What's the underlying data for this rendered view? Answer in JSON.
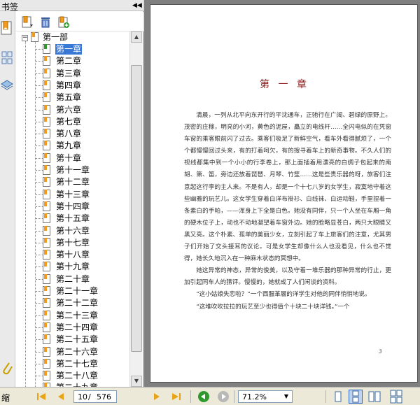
{
  "panel": {
    "title": "书签",
    "collapse_glyph": "◀◀"
  },
  "tree": {
    "expander_glyph": "−",
    "root_label": "第一部",
    "items": [
      "第一章",
      "第二章",
      "第三章",
      "第四章",
      "第五章",
      "第六章",
      "第七章",
      "第八章",
      "第九章",
      "第十章",
      "第十一章",
      "第十二章",
      "第十三章",
      "第十四章",
      "第十五章",
      "第十六章",
      "第十七章",
      "第十八章",
      "第十九章",
      "第二十章",
      "第二十一章",
      "第二十二章",
      "第二十三章",
      "第二十四章",
      "第二十五章",
      "第二十六章",
      "第二十七章",
      "第二十八章",
      "第二十九章"
    ],
    "selected_index": 0
  },
  "document": {
    "chapter_title": "第 一 章",
    "paragraphs": [
      "清晨，一列从北平向东开行的平沈通车，正驰行在广阔、碧绿的原野上。茂密的庄稼，明亮的小河，黄色的泥屋，矗立的电线杆……全闪电似的在凭窗车窗的乘客眼前闪了过去。乘客们吸足了新鲜空气，看车外看得腻烦了，一个个都慢慢回过头来，有的打着呵欠，有的搜寻着车上的新奇事物。不久人们的视线都集中到一个小小的行李卷上，那上面插着用漂亮的白绸子包起来的南胡、箫、笛，旁边还放着琵琶、月琴、竹笙……这是些贵乐器的呀，旅客们注意起这行李的主人来。不是有人，却是一个十七八岁的女学生，寂寞地守着这些幽雅的玩艺儿。这女学生穿着白洋布褂衫、白线袜、白运动鞋，手里捏着一条素白的手帕，——浑身上下全是白色。她没有同伴，只一个人坐在车厢一角的硬木位子上，动也不动地凝望着车窗外边。她的脸略显苍白，两只大眼睛又黑又亮。这个朴素、孤单的美丽少女，立刻引起了车上旅客们的注意，尤其男子们开始了交头接耳的议论。可是女学生却像什么人也没看见，什么也不觉得，她长久地沉入在一种麻木状态的冥想中。",
      "她这异常的神态，异常的俊美，以及守着一堆乐器的那种异常的行止，更加引起同车人的猜评。慢慢的，她就成了人们闲谈的资料。",
      "“这小姑娘失恋啦？”一个西服革履的洋学生对他的同伴悄悄地说。",
      "“这堆吹吹拉拉的玩艺至少也得值个十块二十块洋钱。”一个"
    ],
    "page_number": "3"
  },
  "status": {
    "thumb_label": "缩",
    "current_page": "10",
    "page_sep": "/",
    "total_pages": "576",
    "zoom": "71.2%",
    "zoom_drop_glyph": "▼"
  },
  "colors": {
    "selection": "#3a78d6",
    "chapter_title": "#8b1a1a",
    "nav_green": "#2e9a2e",
    "nav_orange": "#e8a317"
  }
}
